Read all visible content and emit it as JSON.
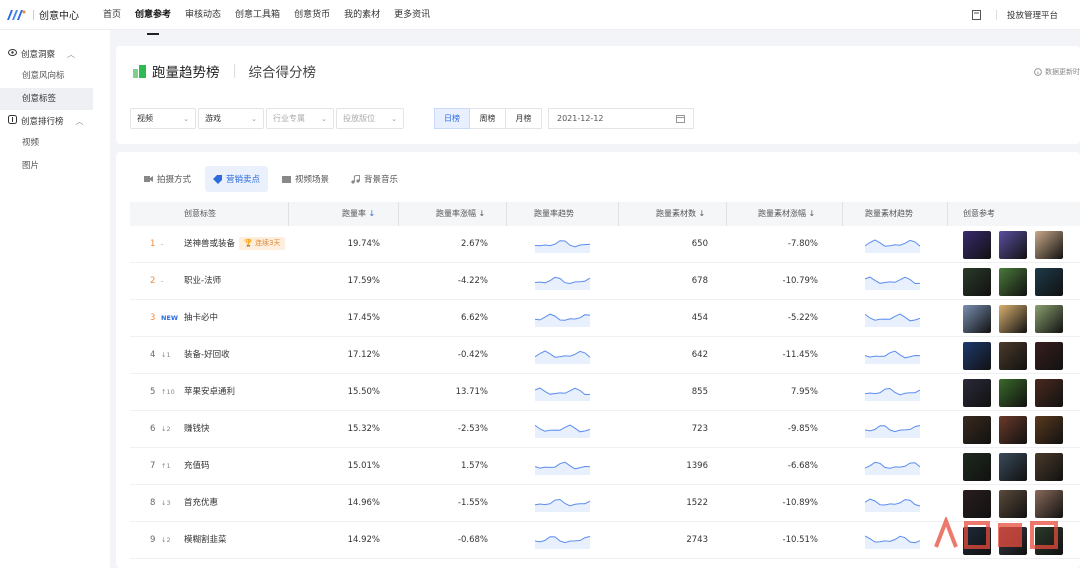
{
  "app": {
    "name": "创意中心"
  },
  "nav": {
    "items": [
      "首页",
      "创意参考",
      "审核动态",
      "创意工具箱",
      "创意货币",
      "我的素材",
      "更多资讯"
    ],
    "active_index": 1
  },
  "topright": {
    "platform_label": "投放管理平台"
  },
  "sidebar": {
    "groups": [
      {
        "label": "创意洞察",
        "items": [
          {
            "label": "创意风向标"
          },
          {
            "label": "创意标签"
          }
        ]
      },
      {
        "label": "创意排行榜",
        "items": [
          {
            "label": "视频"
          },
          {
            "label": "图片"
          }
        ]
      }
    ],
    "active_item": "创意标签"
  },
  "header": {
    "title": "跑量趋势榜",
    "subtitle": "综合得分榜",
    "refresh_note": "数据更新时"
  },
  "filters": {
    "selects": [
      {
        "value": "视频",
        "placeholder": false
      },
      {
        "value": "游戏",
        "placeholder": false
      },
      {
        "value": "行业专属",
        "placeholder": true
      },
      {
        "value": "投放版位",
        "placeholder": true
      }
    ],
    "periods": [
      "日榜",
      "周榜",
      "月榜"
    ],
    "active_period": "日榜",
    "date": "2021-12-12"
  },
  "tabs": {
    "items": [
      "拍摄方式",
      "营销卖点",
      "视频场景",
      "背景音乐"
    ],
    "active": "营销卖点"
  },
  "table": {
    "columns": [
      "创意标签",
      "跑量率",
      "跑量率涨幅",
      "跑量率趋势",
      "跑量素材数",
      "跑量素材涨幅",
      "跑量素材趋势",
      "创意参考"
    ],
    "rows": [
      {
        "rank": "1",
        "change": "-",
        "tag": "送神兽或装备",
        "badge": "连续3天",
        "rate": "19.74%",
        "rate_change": "2.67%",
        "count": "650",
        "count_change": "-7.80%"
      },
      {
        "rank": "2",
        "change": "-",
        "tag": "职业-法师",
        "badge": "",
        "rate": "17.59%",
        "rate_change": "-4.22%",
        "count": "678",
        "count_change": "-10.79%"
      },
      {
        "rank": "3",
        "change": "NEW",
        "tag": "抽卡必中",
        "badge": "",
        "rate": "17.45%",
        "rate_change": "6.62%",
        "count": "454",
        "count_change": "-5.22%"
      },
      {
        "rank": "4",
        "change": "↓1",
        "tag": "装备-好回收",
        "badge": "",
        "rate": "17.12%",
        "rate_change": "-0.42%",
        "count": "642",
        "count_change": "-11.45%"
      },
      {
        "rank": "5",
        "change": "↑10",
        "tag": "苹果安卓通利",
        "badge": "",
        "rate": "15.50%",
        "rate_change": "13.71%",
        "count": "855",
        "count_change": "7.95%"
      },
      {
        "rank": "6",
        "change": "↓2",
        "tag": "赚钱快",
        "badge": "",
        "rate": "15.32%",
        "rate_change": "-2.53%",
        "count": "723",
        "count_change": "-9.85%"
      },
      {
        "rank": "7",
        "change": "↑1",
        "tag": "充值码",
        "badge": "",
        "rate": "15.01%",
        "rate_change": "1.57%",
        "count": "1396",
        "count_change": "-6.68%"
      },
      {
        "rank": "8",
        "change": "↓3",
        "tag": "首充优惠",
        "badge": "",
        "rate": "14.96%",
        "rate_change": "-1.55%",
        "count": "1522",
        "count_change": "-10.89%"
      },
      {
        "rank": "9",
        "change": "↓2",
        "tag": "模糊割韭菜",
        "badge": "",
        "rate": "14.92%",
        "rate_change": "-0.68%",
        "count": "2743",
        "count_change": "-10.51%"
      }
    ]
  },
  "colors": {
    "accent": "#2d6cdf",
    "rank_top": "#f08a3c",
    "brand_green": "#2dba4e"
  },
  "watermark": "人人都是"
}
